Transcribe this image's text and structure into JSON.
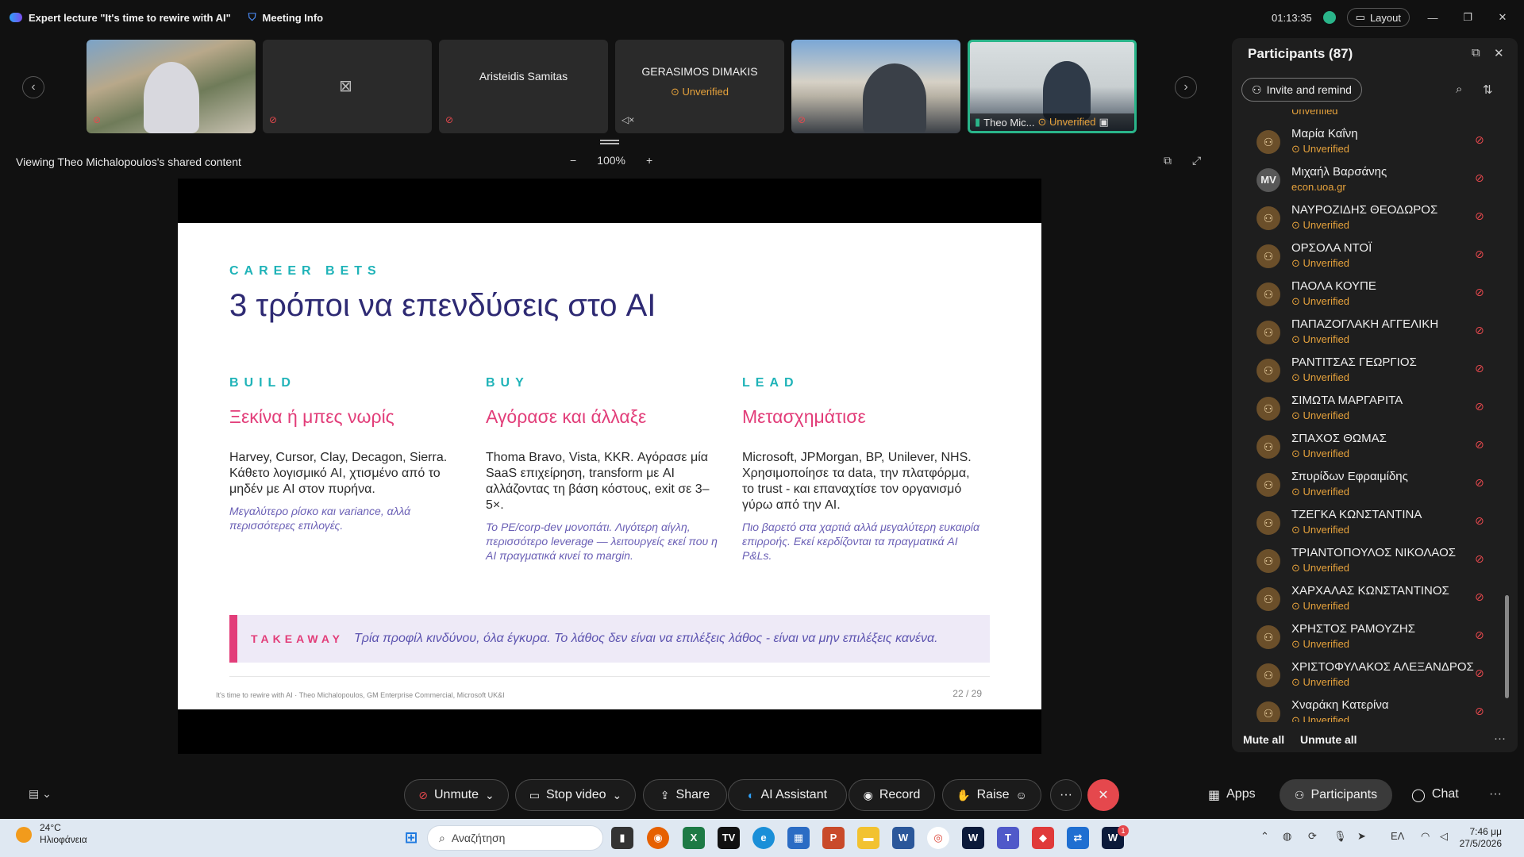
{
  "window": {
    "title": "Expert lecture \"It's time to rewire with AI\"",
    "meeting_info": "Meeting Info",
    "timer": "01:13:35",
    "layout_label": "Layout"
  },
  "video_tiles": [
    {
      "name": "",
      "status": ""
    },
    {
      "name": "",
      "status": ""
    },
    {
      "name": "Aristeidis Samitas",
      "status": ""
    },
    {
      "name": "GERASIMOS DIMAKIS",
      "status": "Unverified"
    },
    {
      "name": "",
      "status": ""
    },
    {
      "name": "Theo Mic...",
      "status": "Unverified"
    }
  ],
  "share": {
    "viewing_text": "Viewing Theo Michalopoulos's shared content",
    "zoom_minus": "−",
    "zoom_level": "100%",
    "zoom_plus": "+"
  },
  "slide": {
    "kicker": "CAREER BETS",
    "title": "3 τρόποι να επενδύσεις στο AI",
    "columns": [
      {
        "heading": "BUILD",
        "subheading": "Ξεκίνα ή μπες νωρίς",
        "body": "Harvey, Cursor, Clay, Decagon, Sierra. Κάθετο λογισμικό AI, χτισμένο από το μηδέν με AI στον πυρήνα.",
        "note": "Μεγαλύτερο ρίσκο και variance, αλλά περισσότερες επιλογές."
      },
      {
        "heading": "BUY",
        "subheading": "Αγόρασε και άλλαξε",
        "body": "Thoma Bravo, Vista, KKR. Αγόρασε μία SaaS επιχείρηση, transform με AI αλλάζοντας τη βάση κόστους, exit σε 3–5×.",
        "note": "Το PE/corp-dev μονοπάτι. Λιγότερη αίγλη, περισσότερο leverage — λειτουργείς εκεί που η AI πραγματικά κινεί το margin."
      },
      {
        "heading": "LEAD",
        "subheading": "Μετασχημάτισε",
        "body": "Microsoft, JPMorgan, BP, Unilever, NHS. Χρησιμοποίησε τα data, την πλατφόρμα, το trust - και επαναχτίσε τον οργανισμό γύρω από την AI.",
        "note": "Πιο βαρετό στα χαρτιά αλλά μεγαλύτερη ευκαιρία επιρροής. Εκεί κερδίζονται τα πραγματικά AI P&Ls."
      }
    ],
    "takeaway_label": "TAKEAWAY",
    "takeaway_text": "Τρία προφίλ κινδύνου, όλα έγκυρα. Το λάθος δεν είναι να επιλέξεις λάθος - είναι να μην επιλέξεις κανένα.",
    "footer": "It's time to rewire with AI · Theo Michalopoulos, GM Enterprise Commercial, Microsoft UK&I",
    "page": "22 / 29"
  },
  "participants_panel": {
    "title": "Participants (87)",
    "invite_label": "Invite and remind",
    "mute_all": "Mute all",
    "unmute_all": "Unmute all",
    "rows": [
      {
        "name": "Μαρία Καΐνη",
        "status": "Unverified",
        "avatar": "person"
      },
      {
        "name": "Μιχαήλ Βαρσάνης",
        "status": "econ.uoa.gr",
        "avatar": "MV"
      },
      {
        "name": "ΝΑΥΡΟΖΙΔΗΣ ΘΕΟΔΩΡΟΣ",
        "status": "Unverified",
        "avatar": "person"
      },
      {
        "name": "ΟΡΣΟΛΑ ΝΤΟΪ",
        "status": "Unverified",
        "avatar": "person"
      },
      {
        "name": "ΠΑΟΛΑ ΚΟΥΠΕ",
        "status": "Unverified",
        "avatar": "person"
      },
      {
        "name": "ΠΑΠΑΖΟΓΛΑΚΗ ΑΓΓΕΛΙΚΗ",
        "status": "Unverified",
        "avatar": "person"
      },
      {
        "name": "ΡΑΝΤΙΤΣΑΣ ΓΕΩΡΓΙΟΣ",
        "status": "Unverified",
        "avatar": "person"
      },
      {
        "name": "ΣΙΜΩΤΑ ΜΑΡΓΑΡΙΤΑ",
        "status": "Unverified",
        "avatar": "person"
      },
      {
        "name": "ΣΠΑΧΟΣ ΘΩΜΑΣ",
        "status": "Unverified",
        "avatar": "person"
      },
      {
        "name": "Σπυρίδων Εφραιμίδης",
        "status": "Unverified",
        "avatar": "person"
      },
      {
        "name": "ΤΖΕΓΚΑ ΚΩΝΣΤΑΝΤΙΝΑ",
        "status": "Unverified",
        "avatar": "person"
      },
      {
        "name": "ΤΡΙΑΝΤΟΠΟΥΛΟΣ ΝΙΚΟΛΑΟΣ",
        "status": "Unverified",
        "avatar": "person"
      },
      {
        "name": "ΧΑΡΧΑΛΑΣ ΚΩΝΣΤΑΝΤΙΝΟΣ",
        "status": "Unverified",
        "avatar": "person"
      },
      {
        "name": "ΧΡΗΣΤΟΣ ΡΑΜΟΥΖΗΣ",
        "status": "Unverified",
        "avatar": "person"
      },
      {
        "name": "ΧΡΙΣΤΟΦΥΛΑΚΟΣ ΑΛΕΞΑΝΔΡΟΣ",
        "status": "Unverified",
        "avatar": "person"
      },
      {
        "name": "Χναράκη Κατερίνα",
        "status": "Unverified",
        "avatar": "person"
      }
    ]
  },
  "toolbar": {
    "unmute": "Unmute",
    "stop_video": "Stop video",
    "share": "Share",
    "ai_assistant": "AI Assistant",
    "record": "Record",
    "raise": "Raise",
    "apps": "Apps",
    "participants": "Participants",
    "chat": "Chat"
  },
  "taskbar": {
    "temperature": "24°C",
    "weather": "Ηλιοφάνεια",
    "search_placeholder": "Αναζήτηση",
    "language": "ΕΛ",
    "time": "7:46 μμ",
    "date": "27/5/2026",
    "badge_count": "1"
  },
  "colors": {
    "accent_teal": "#1fb3b8",
    "accent_pink": "#e23d79",
    "title_indigo": "#2e2a73",
    "unverified_orange": "#e6a23c",
    "muted_red": "#e5484d",
    "active_speaker_green": "#2ab58a"
  }
}
